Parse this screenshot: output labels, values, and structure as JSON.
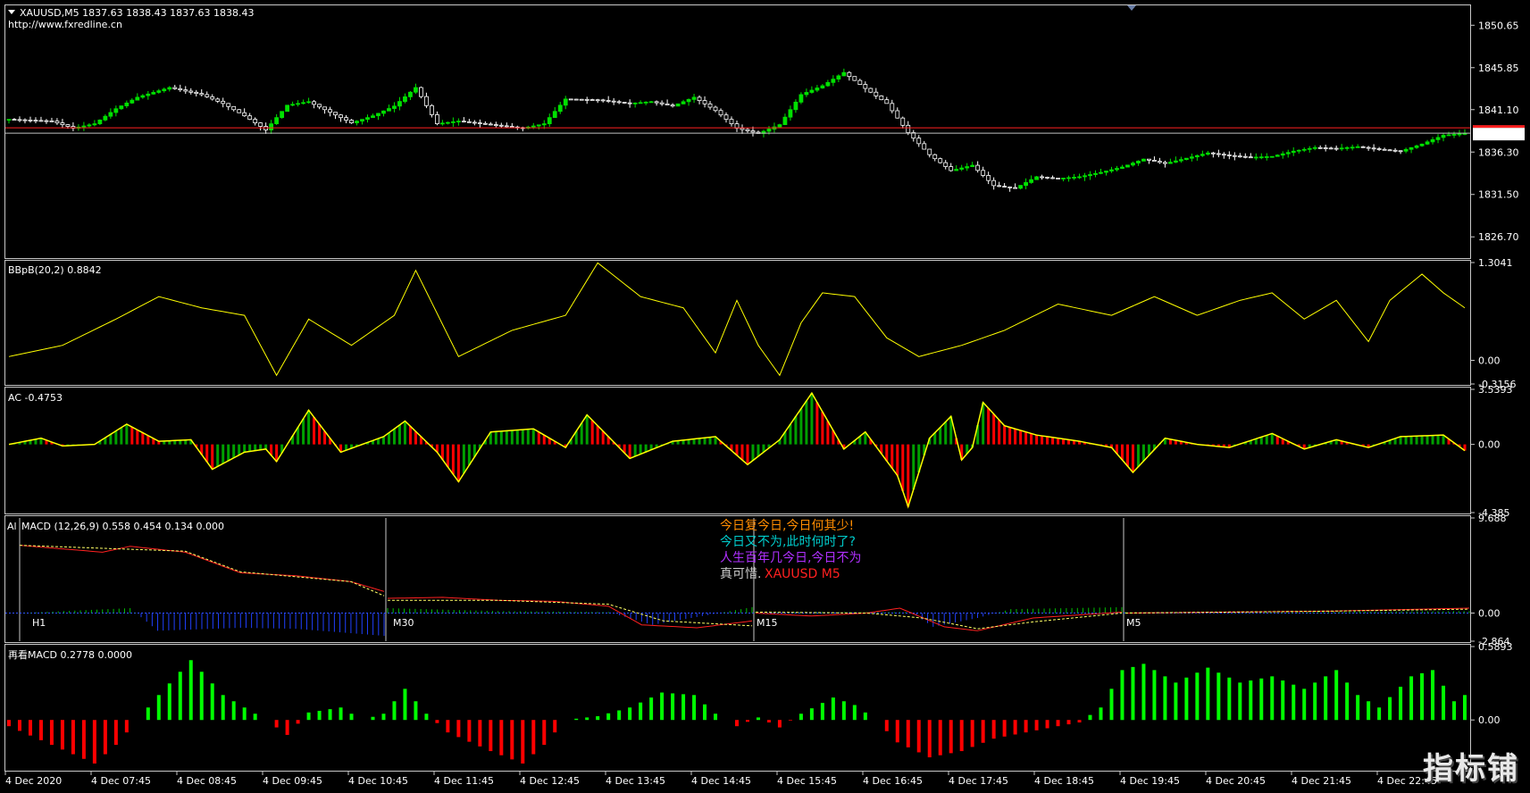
{
  "colors": {
    "background": "#000000",
    "frame": "#c8c8c8",
    "bull": "#00e000",
    "bear": "#ffffff",
    "price_line": "#ff2020",
    "bbpb": "#ffff00",
    "ac_up": "#00a000",
    "ac_down": "#ff0000",
    "ac_line": "#ffff00",
    "macd_main": "#ff2020",
    "macd_signal": "#ffff66",
    "macd_hist": "#00c000",
    "macd_hist_neg": "#2040ff",
    "rmacd_up": "#00ff00",
    "rmacd_down": "#ff0000"
  },
  "header": {
    "symbol_line": "XAUUSD,M5  1837.63 1838.43 1837.63 1838.43",
    "url": "http://www.fxredline.cn"
  },
  "current_price_label": "1838.43",
  "panes": {
    "bbpb": {
      "title": "BBpB(20,2) 0.8842",
      "ticks": [
        "1.3041",
        "0.00",
        "-0.3156"
      ]
    },
    "ac": {
      "title": "AC -0.4753",
      "ticks": [
        "3.5393",
        "0.00",
        "-4.385"
      ]
    },
    "macd": {
      "title": "MACD (12,26,9) 0.558 0.454 0.134 0.000",
      "prefix": "Al",
      "ticks": [
        "9.688",
        "0.00",
        "-2.864"
      ],
      "tf_labels": [
        "H1",
        "M30",
        "M15",
        "M5"
      ]
    },
    "rmacd": {
      "title": "再看MACD 0.2778 0.0000",
      "ticks": [
        "0.5893",
        "0.00"
      ]
    }
  },
  "quotes": [
    {
      "text": "今日复今日,今日何其少!",
      "color": "#ff8c00"
    },
    {
      "text": "今日又不为,此时何时了?",
      "color": "#00cccc"
    },
    {
      "text": "人生百年几今日,今日不为",
      "color": "#b030ff"
    },
    {
      "text": "真可惜.",
      "color": "#cccccc"
    }
  ],
  "symbol_tag": "XAUUSD  M5",
  "watermark": "指标铺",
  "chart_data": {
    "type": "candlestick",
    "price_axis": {
      "ticks": [
        1850.65,
        1845.85,
        1841.1,
        1836.3,
        1831.5,
        1826.7
      ],
      "ylim": [
        1824.5,
        1852.7
      ]
    },
    "current_price": 1838.43,
    "time_axis": [
      "4 Dec 2020",
      "4 Dec 07:45",
      "4 Dec 08:45",
      "4 Dec 09:45",
      "4 Dec 10:45",
      "4 Dec 11:45",
      "4 Dec 12:45",
      "4 Dec 13:45",
      "4 Dec 14:45",
      "4 Dec 15:45",
      "4 Dec 16:45",
      "4 Dec 17:45",
      "4 Dec 18:45",
      "4 Dec 19:45",
      "4 Dec 20:45",
      "4 Dec 21:45",
      "4 Dec 22:45"
    ],
    "close_keypoints": [
      [
        0,
        1840.0
      ],
      [
        8,
        1839.8
      ],
      [
        12,
        1839.0
      ],
      [
        16,
        1839.5
      ],
      [
        20,
        1841.2
      ],
      [
        24,
        1842.5
      ],
      [
        30,
        1843.6
      ],
      [
        36,
        1842.8
      ],
      [
        40,
        1841.8
      ],
      [
        44,
        1840.4
      ],
      [
        48,
        1838.8
      ],
      [
        52,
        1841.6
      ],
      [
        56,
        1842.0
      ],
      [
        60,
        1840.8
      ],
      [
        64,
        1839.6
      ],
      [
        68,
        1840.4
      ],
      [
        72,
        1841.5
      ],
      [
        76,
        1843.6
      ],
      [
        80,
        1839.5
      ],
      [
        84,
        1839.8
      ],
      [
        90,
        1839.4
      ],
      [
        96,
        1839.0
      ],
      [
        100,
        1839.5
      ],
      [
        104,
        1842.3
      ],
      [
        110,
        1842.2
      ],
      [
        116,
        1841.8
      ],
      [
        120,
        1842.0
      ],
      [
        124,
        1841.5
      ],
      [
        128,
        1842.5
      ],
      [
        132,
        1841.0
      ],
      [
        136,
        1839.0
      ],
      [
        140,
        1838.4
      ],
      [
        144,
        1839.4
      ],
      [
        148,
        1842.8
      ],
      [
        152,
        1843.8
      ],
      [
        156,
        1845.3
      ],
      [
        160,
        1843.5
      ],
      [
        164,
        1841.8
      ],
      [
        168,
        1838.5
      ],
      [
        172,
        1836.0
      ],
      [
        176,
        1834.2
      ],
      [
        180,
        1834.8
      ],
      [
        184,
        1832.5
      ],
      [
        188,
        1832.2
      ],
      [
        192,
        1833.5
      ],
      [
        196,
        1833.3
      ],
      [
        200,
        1833.5
      ],
      [
        204,
        1834.0
      ],
      [
        208,
        1834.6
      ],
      [
        212,
        1835.5
      ],
      [
        216,
        1835.0
      ],
      [
        220,
        1835.6
      ],
      [
        224,
        1836.2
      ],
      [
        228,
        1835.9
      ],
      [
        232,
        1835.7
      ],
      [
        236,
        1835.8
      ],
      [
        240,
        1836.4
      ],
      [
        244,
        1836.8
      ],
      [
        248,
        1836.7
      ],
      [
        252,
        1836.9
      ],
      [
        256,
        1836.6
      ],
      [
        260,
        1836.4
      ],
      [
        264,
        1837.2
      ],
      [
        268,
        1838.2
      ],
      [
        272,
        1838.4
      ]
    ],
    "bbpb": {
      "ylim": [
        -0.3156,
        1.3041
      ],
      "keypoints": [
        [
          0,
          0.05
        ],
        [
          10,
          0.2
        ],
        [
          20,
          0.55
        ],
        [
          28,
          0.85
        ],
        [
          36,
          0.7
        ],
        [
          44,
          0.6
        ],
        [
          50,
          -0.2
        ],
        [
          56,
          0.55
        ],
        [
          64,
          0.2
        ],
        [
          72,
          0.6
        ],
        [
          76,
          1.2
        ],
        [
          84,
          0.05
        ],
        [
          94,
          0.4
        ],
        [
          104,
          0.6
        ],
        [
          110,
          1.3
        ],
        [
          118,
          0.85
        ],
        [
          126,
          0.7
        ],
        [
          130,
          0.3
        ],
        [
          132,
          0.1
        ],
        [
          136,
          0.8
        ],
        [
          140,
          0.2
        ],
        [
          144,
          -0.2
        ],
        [
          148,
          0.5
        ],
        [
          152,
          0.9
        ],
        [
          158,
          0.85
        ],
        [
          164,
          0.3
        ],
        [
          170,
          0.05
        ],
        [
          178,
          0.2
        ],
        [
          186,
          0.4
        ],
        [
          196,
          0.75
        ],
        [
          206,
          0.6
        ],
        [
          214,
          0.85
        ],
        [
          222,
          0.6
        ],
        [
          230,
          0.8
        ],
        [
          236,
          0.9
        ],
        [
          242,
          0.55
        ],
        [
          248,
          0.8
        ],
        [
          254,
          0.25
        ],
        [
          258,
          0.8
        ],
        [
          264,
          1.15
        ],
        [
          268,
          0.9
        ],
        [
          272,
          0.7
        ]
      ]
    },
    "ac": {
      "ylim": [
        -4.385,
        3.5393
      ],
      "keypoints": [
        [
          0,
          0.0
        ],
        [
          6,
          0.4
        ],
        [
          10,
          -0.1
        ],
        [
          16,
          0.0
        ],
        [
          22,
          1.3
        ],
        [
          28,
          0.2
        ],
        [
          34,
          0.3
        ],
        [
          38,
          -1.6
        ],
        [
          44,
          -0.5
        ],
        [
          48,
          -0.3
        ],
        [
          50,
          -1.1
        ],
        [
          56,
          2.2
        ],
        [
          62,
          -0.5
        ],
        [
          70,
          0.5
        ],
        [
          74,
          1.5
        ],
        [
          80,
          -0.5
        ],
        [
          84,
          -2.4
        ],
        [
          90,
          0.8
        ],
        [
          98,
          1.0
        ],
        [
          104,
          -0.2
        ],
        [
          108,
          1.9
        ],
        [
          116,
          -0.9
        ],
        [
          124,
          0.2
        ],
        [
          132,
          0.5
        ],
        [
          138,
          -1.3
        ],
        [
          144,
          0.3
        ],
        [
          150,
          3.3
        ],
        [
          156,
          -0.3
        ],
        [
          160,
          0.8
        ],
        [
          166,
          -2.0
        ],
        [
          168,
          -4.0
        ],
        [
          172,
          0.4
        ],
        [
          176,
          1.8
        ],
        [
          178,
          -1.0
        ],
        [
          180,
          -0.2
        ],
        [
          182,
          2.7
        ],
        [
          186,
          1.2
        ],
        [
          192,
          0.6
        ],
        [
          200,
          0.2
        ],
        [
          206,
          -0.2
        ],
        [
          210,
          -1.8
        ],
        [
          216,
          0.4
        ],
        [
          222,
          0.0
        ],
        [
          228,
          -0.2
        ],
        [
          236,
          0.7
        ],
        [
          242,
          -0.3
        ],
        [
          248,
          0.3
        ],
        [
          254,
          -0.2
        ],
        [
          260,
          0.5
        ],
        [
          268,
          0.6
        ],
        [
          272,
          -0.4
        ]
      ]
    },
    "macd": {
      "ylim": [
        -2.864,
        9.688
      ],
      "sections": [
        {
          "main": [
            [
              0,
              6.9
            ],
            [
              15,
              6.2
            ],
            [
              20,
              6.8
            ],
            [
              30,
              6.2
            ],
            [
              40,
              4.1
            ],
            [
              50,
              3.8
            ],
            [
              60,
              3.2
            ],
            [
              66,
              2.2
            ],
            [
              70,
              0.3
            ]
          ],
          "signal": [
            [
              0,
              6.9
            ],
            [
              30,
              6.3
            ],
            [
              40,
              4.2
            ],
            [
              60,
              3.2
            ],
            [
              70,
              0.8
            ]
          ],
          "hist": [
            [
              0,
              0
            ],
            [
              20,
              0.5
            ],
            [
              25,
              -1.8
            ],
            [
              40,
              -1.5
            ],
            [
              50,
              -1.6
            ],
            [
              70,
              -2.5
            ]
          ]
        },
        {
          "main": [
            [
              0,
              1.5
            ],
            [
              10,
              1.6
            ],
            [
              20,
              1.3
            ],
            [
              30,
              1.2
            ],
            [
              40,
              0.7
            ],
            [
              46,
              -1.2
            ],
            [
              56,
              -1.5
            ],
            [
              66,
              -0.8
            ]
          ],
          "signal": [
            [
              0,
              1.3
            ],
            [
              20,
              1.3
            ],
            [
              40,
              0.9
            ],
            [
              50,
              -0.8
            ],
            [
              66,
              -1.3
            ]
          ],
          "hist": [
            [
              0,
              0.5
            ],
            [
              20,
              0.2
            ],
            [
              40,
              0.1
            ],
            [
              48,
              -1.2
            ],
            [
              56,
              -0.4
            ],
            [
              66,
              0.6
            ]
          ]
        },
        {
          "main": [
            [
              0,
              0.0
            ],
            [
              10,
              -0.3
            ],
            [
              20,
              0.0
            ],
            [
              26,
              0.5
            ],
            [
              34,
              -1.4
            ],
            [
              40,
              -1.8
            ],
            [
              50,
              -0.5
            ],
            [
              66,
              0.1
            ]
          ],
          "signal": [
            [
              0,
              0.1
            ],
            [
              20,
              0.0
            ],
            [
              30,
              -0.5
            ],
            [
              40,
              -1.6
            ],
            [
              50,
              -0.9
            ],
            [
              66,
              0.0
            ]
          ],
          "hist": [
            [
              0,
              0.1
            ],
            [
              28,
              0.1
            ],
            [
              32,
              -1.4
            ],
            [
              40,
              -0.5
            ],
            [
              46,
              0.4
            ],
            [
              66,
              0.6
            ]
          ]
        },
        {
          "main": [
            [
              0,
              0.0
            ],
            [
              40,
              0.2
            ],
            [
              66,
              0.5
            ]
          ],
          "signal": [
            [
              0,
              0.0
            ],
            [
              40,
              0.2
            ],
            [
              66,
              0.4
            ]
          ],
          "hist": [
            [
              0,
              0.1
            ],
            [
              66,
              0.2
            ]
          ]
        }
      ]
    },
    "rmacd": {
      "ylim": [
        -0.4,
        0.5893
      ],
      "keypoints": [
        [
          0,
          -0.05
        ],
        [
          8,
          -0.2
        ],
        [
          16,
          -0.35
        ],
        [
          20,
          -0.2
        ],
        [
          24,
          0.0
        ],
        [
          28,
          0.2
        ],
        [
          34,
          0.48
        ],
        [
          40,
          0.2
        ],
        [
          48,
          0.0
        ],
        [
          52,
          -0.12
        ],
        [
          56,
          0.06
        ],
        [
          62,
          0.1
        ],
        [
          66,
          0.0
        ],
        [
          70,
          0.05
        ],
        [
          74,
          0.25
        ],
        [
          78,
          0.05
        ],
        [
          82,
          -0.1
        ],
        [
          90,
          -0.25
        ],
        [
          96,
          -0.35
        ],
        [
          100,
          -0.2
        ],
        [
          104,
          0.0
        ],
        [
          110,
          0.03
        ],
        [
          116,
          0.1
        ],
        [
          122,
          0.22
        ],
        [
          128,
          0.2
        ],
        [
          132,
          0.05
        ],
        [
          136,
          -0.05
        ],
        [
          140,
          0.02
        ],
        [
          144,
          -0.06
        ],
        [
          148,
          0.05
        ],
        [
          154,
          0.18
        ],
        [
          158,
          0.12
        ],
        [
          162,
          0.0
        ],
        [
          166,
          -0.18
        ],
        [
          172,
          -0.3
        ],
        [
          178,
          -0.25
        ],
        [
          184,
          -0.15
        ],
        [
          190,
          -0.1
        ],
        [
          196,
          -0.05
        ],
        [
          200,
          -0.02
        ],
        [
          204,
          0.1
        ],
        [
          208,
          0.4
        ],
        [
          212,
          0.45
        ],
        [
          218,
          0.3
        ],
        [
          224,
          0.42
        ],
        [
          230,
          0.3
        ],
        [
          236,
          0.35
        ],
        [
          242,
          0.25
        ],
        [
          248,
          0.4
        ],
        [
          252,
          0.2
        ],
        [
          256,
          0.1
        ],
        [
          262,
          0.35
        ],
        [
          266,
          0.4
        ],
        [
          270,
          0.15
        ],
        [
          272,
          0.2
        ]
      ]
    }
  }
}
